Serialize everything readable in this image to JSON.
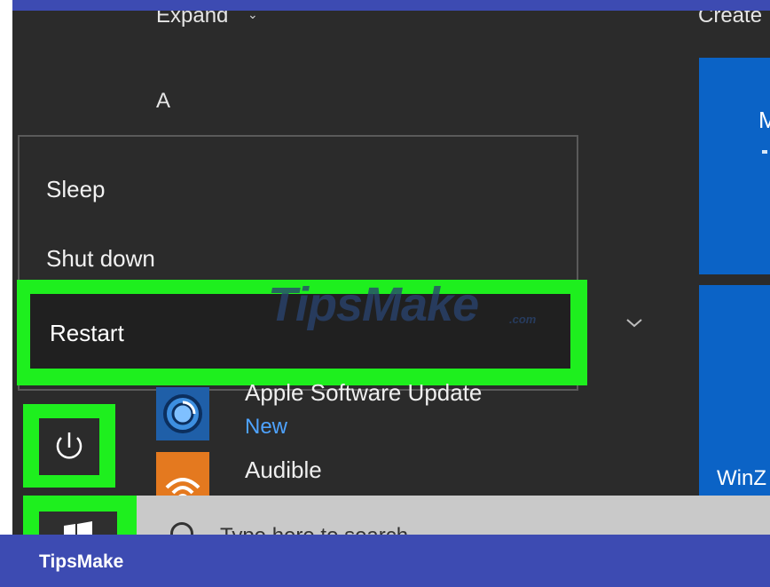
{
  "start_menu": {
    "expand_label": "Expand",
    "create_label": "Create",
    "section_letter": "A",
    "tiles": {
      "tile1_text": "M",
      "tile2_text": "WinZ"
    }
  },
  "power_menu": {
    "items": [
      {
        "label": "Sleep"
      },
      {
        "label": "Shut down"
      },
      {
        "label": "Restart",
        "highlighted": true
      }
    ]
  },
  "apps": [
    {
      "name": "Apple Software Update",
      "badge": "New",
      "icon": "apple-update-icon"
    },
    {
      "name": "Audible",
      "icon": "audible-icon"
    }
  ],
  "taskbar": {
    "search_placeholder": "Type here to search"
  },
  "watermark": {
    "text": "TipsMake",
    "suffix": ".com"
  },
  "footer": {
    "brand": "TipsMake"
  },
  "colors": {
    "highlight": "#1eef1e",
    "tile_blue": "#0b63c6",
    "menu_bg": "#2b2b2b",
    "frame_blue": "#3d4bb2"
  }
}
